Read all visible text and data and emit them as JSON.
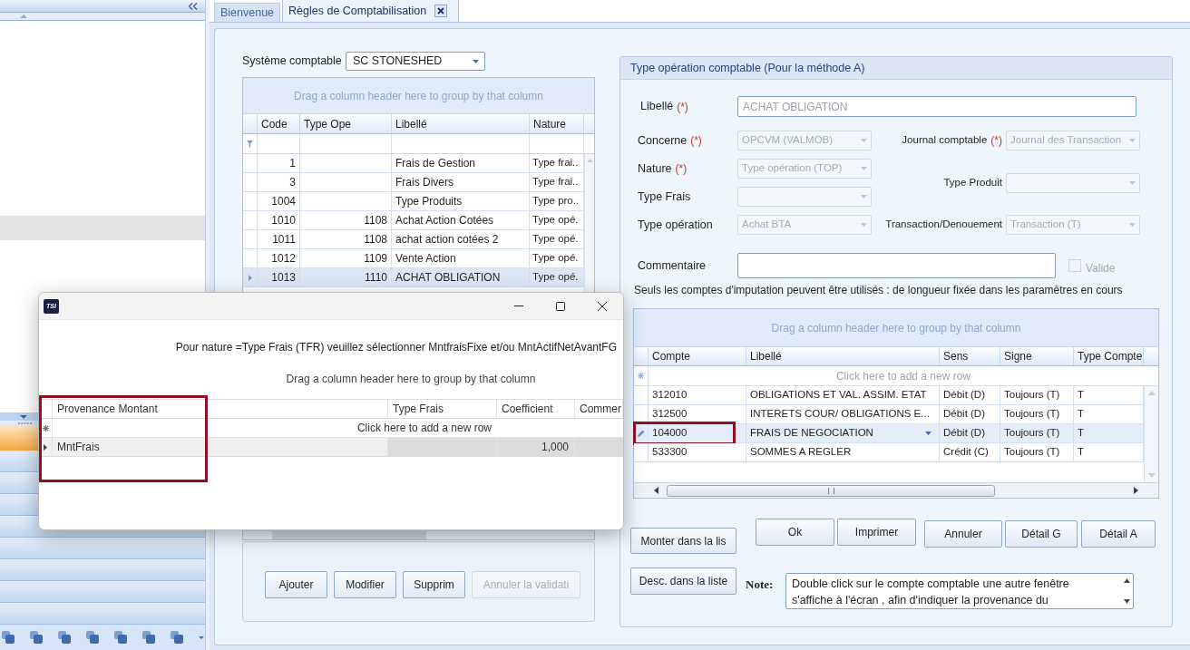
{
  "tabs": [
    {
      "label": "Bienvenue",
      "selected": false,
      "closable": false
    },
    {
      "label": "Règles de Comptabilisation",
      "selected": true,
      "closable": true
    }
  ],
  "accounting_system": {
    "label": "Système comptable",
    "value": "SC STONESHED"
  },
  "operations_grid": {
    "group_hint": "Drag a column header here to group by that column",
    "columns": [
      "Code",
      "Type Ope",
      "Libellé",
      "Nature"
    ],
    "rows": [
      {
        "code": "1",
        "libelle": "Frais de Gestion",
        "nature": "Type frai..",
        "selected": false
      },
      {
        "code": "3",
        "libelle": "Frais Divers",
        "nature": "Type frai..",
        "selected": false
      },
      {
        "code": "1004",
        "libelle": "Type Produits",
        "nature": "Type pro..",
        "selected": false
      },
      {
        "code": "1010",
        "type_ope": "1108",
        "libelle": "Achat Action Cotées",
        "nature": "Type opé.",
        "selected": false
      },
      {
        "code": "1011",
        "type_ope": "1108",
        "libelle": "achat action cotées 2",
        "nature": "Type opé.",
        "selected": false
      },
      {
        "code": "1012",
        "type_ope": "1109",
        "libelle": "Vente Action",
        "nature": "Type opé.",
        "selected": false
      },
      {
        "code": "1013",
        "type_ope": "1110",
        "libelle": "ACHAT OBLIGATION",
        "nature": "Type opé.",
        "selected": true
      }
    ]
  },
  "operations_buttons": [
    {
      "label": "Ajouter",
      "disabled": false
    },
    {
      "label": "Modifier",
      "disabled": false
    },
    {
      "label": "Supprim",
      "disabled": false
    },
    {
      "label": "Annuler la validati",
      "disabled": true
    }
  ],
  "operation_form": {
    "title": "Type opération comptable (Pour la méthode A)",
    "libelle": {
      "label": "Libellé",
      "required_mark": "(*)",
      "value": "ACHAT OBLIGATION",
      "disabled": true
    },
    "left_fields": [
      {
        "label": "Concerne",
        "required_mark": "(*)",
        "value": "OPCVM (VALMOB)",
        "disabled": true
      },
      {
        "label": "Nature",
        "required_mark": "(*)",
        "value": "Type opération (TOP)",
        "disabled": true
      },
      {
        "label": "Type Frais",
        "disabled": true
      },
      {
        "label": "Type opération",
        "value": "Achat BTA",
        "disabled": true
      }
    ],
    "right_fields": [
      {
        "label": "Journal comptable",
        "required_mark": "(*)",
        "value": "Journal des Transaction",
        "disabled": true
      },
      {
        "label": "Type Produit",
        "disabled": true
      },
      {
        "label": "Transaction/Denouement",
        "value": "Transaction (T)",
        "disabled": true
      }
    ],
    "commentaire": {
      "label": "Commentaire"
    },
    "valide": {
      "label": "Valide",
      "checked": false,
      "disabled": true
    },
    "notice": "Seuls les comptes d'imputation peuvent être utilisés : de longueur fixée dans les paramètres en cours"
  },
  "accounts_grid": {
    "group_hint": "Drag a column header here to group by that column",
    "columns": [
      "Compte",
      "Libellé",
      "Sens",
      "Signe",
      "Type Compte"
    ],
    "new_row_hint": "Click here to add a new row",
    "rows": [
      {
        "compte": "312010",
        "libelle": "OBLIGATIONS ET VAL. ASSIM. ETAT",
        "sens": "Débit (D)",
        "signe": "Toujours (T)",
        "type_compte": "T",
        "selected": false,
        "highlighted": false
      },
      {
        "compte": "312500",
        "libelle": "INTERETS COUR/ OBLIGATIONS E...",
        "sens": "Débit (D)",
        "signe": "Toujours (T)",
        "type_compte": "T",
        "selected": false,
        "highlighted": false
      },
      {
        "compte": "104000",
        "libelle": "FRAIS DE NEGOCIATION",
        "sens": "Débit (D)",
        "signe": "Toujours (T)",
        "type_compte": "T",
        "selected": true,
        "highlighted": true
      },
      {
        "compte": "533300",
        "libelle": "SOMMES A REGLER",
        "sens": "Crédit (C)",
        "signe": "Toujours (T)",
        "type_compte": "T",
        "selected": false,
        "highlighted": false
      }
    ]
  },
  "list_buttons": [
    "Monter dans la lis",
    "Desc. dans la liste"
  ],
  "action_buttons": [
    [
      "Ok",
      "Imprimer"
    ],
    [
      "Annuler",
      "Détail G",
      "Détail A"
    ]
  ],
  "note": {
    "label": "Note:",
    "value": "Double click sur le compte comptable une autre fenêtre s'affiche à l'écran , afin d'indiquer la provenance du"
  },
  "dialog": {
    "logo": "TSI",
    "message": "Pour nature =Type Frais (TFR) veuillez sélectionner MntfraisFixe et/ou MntActifNetAvantFG",
    "group_hint": "Drag a column header here to group by that column",
    "columns": [
      {
        "label": "Provenance Montant",
        "highlighted": true
      },
      {
        "label": "Type Frais",
        "highlighted": false
      },
      {
        "label": "Coefficient",
        "highlighted": false
      },
      {
        "label": "Commer",
        "highlighted": false
      }
    ],
    "new_row_hint": "Click here to add a new row",
    "rows": [
      {
        "provenance": "MntFrais",
        "coefficient": "1,000",
        "selected": true
      }
    ]
  }
}
